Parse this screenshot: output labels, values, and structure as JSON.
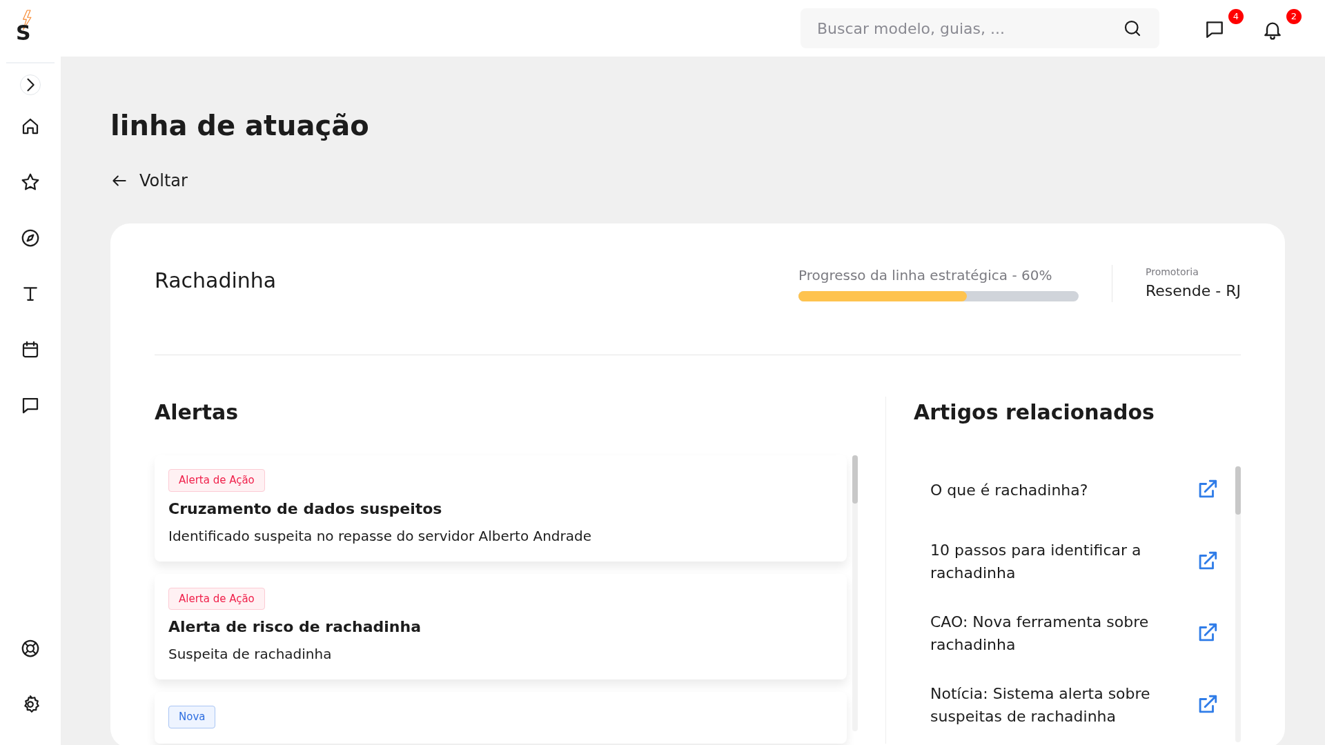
{
  "logo": {
    "letter": "S"
  },
  "search": {
    "placeholder": "Buscar modelo, guias, ..."
  },
  "header_icons": [
    {
      "badge": "4"
    },
    {
      "badge": "2"
    }
  ],
  "page_title": "linha de atuação",
  "back_link": "Voltar",
  "line": {
    "title": "Rachadinha",
    "progress_label": "Progresso da linha estratégica - 60%",
    "level": 0.6,
    "promotoria_label": "Promotoria",
    "promotoria": "Resende - RJ"
  },
  "alerts": {
    "title": "Alertas",
    "items": [
      {
        "tag": "Alerta de Ação",
        "kind": "action",
        "title": "Cruzamento de dados suspeitos",
        "description": "Identificado suspeita no repasse do servidor Alberto Andrade"
      },
      {
        "tag": "Alerta de Ação",
        "kind": "action",
        "title": "Alerta de risco de rachadinha",
        "description": "Suspeita de rachadinha"
      },
      {
        "tag": "Nova",
        "kind": "new"
      }
    ]
  },
  "articles": {
    "title": "Artigos relacionados",
    "items": [
      {
        "title": "O que é rachadinha?"
      },
      {
        "title": "10 passos para identificar a rachadinha"
      },
      {
        "title": "CAO: Nova ferramenta sobre rachadinha"
      },
      {
        "title": "Notícia: Sistema alerta sobre suspeitas de rachadinha"
      }
    ]
  }
}
